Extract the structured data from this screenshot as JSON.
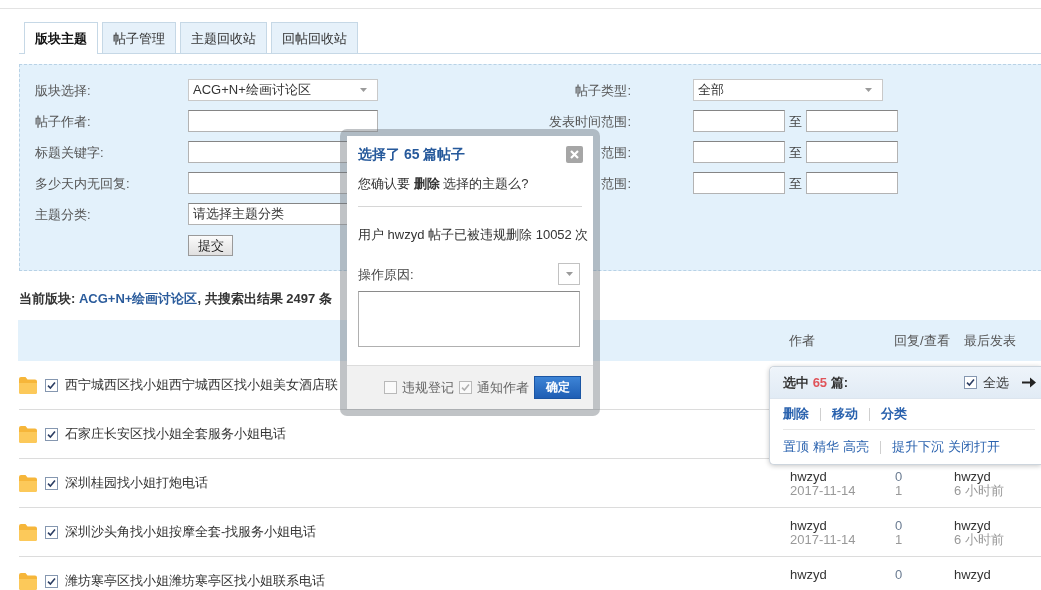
{
  "tabs": [
    {
      "label": "版块主题",
      "selected": true
    },
    {
      "label": "帖子管理",
      "selected": false
    },
    {
      "label": "主题回收站",
      "selected": false
    },
    {
      "label": "回帖回收站",
      "selected": false
    }
  ],
  "search_form": {
    "left_fields": [
      {
        "label": "版块选择:",
        "kind": "select",
        "value": "ACG+N+绘画讨论区"
      },
      {
        "label": "帖子作者:",
        "kind": "text"
      },
      {
        "label": "标题关键字:",
        "kind": "text"
      },
      {
        "label": "多少天内无回复:",
        "kind": "text"
      },
      {
        "label": "主题分类:",
        "kind": "text",
        "value": "请选择主题分类"
      }
    ],
    "right_fields": [
      {
        "label": "帖子类型:",
        "kind": "select",
        "value": "全部"
      },
      {
        "label": "发表时间范围:",
        "kind": "range",
        "separator": "至"
      },
      {
        "label": "范围:",
        "kind": "range",
        "separator": "至"
      },
      {
        "label": "范围:",
        "kind": "range",
        "separator": "至"
      }
    ],
    "submit_button": "提交"
  },
  "summary": {
    "prefix": "当前版块:",
    "forum": "ACG+N+绘画讨论区",
    "suffix": ", 共搜索出结果 2497 条"
  },
  "table": {
    "columns": [
      {
        "label": "作者"
      },
      {
        "label": "回复/查看"
      },
      {
        "label": "最后发表"
      }
    ],
    "rows": [
      {
        "title": "西宁城西区找小姐西宁城西区找小姐美女酒店联",
        "checked": true
      },
      {
        "title": "石家庄长安区找小姐全套服务小姐电话",
        "checked": true
      },
      {
        "title": "深圳桂园找小姐打炮电话",
        "checked": true,
        "author": "hwzyd",
        "date": "2017-11-14",
        "replies": "0",
        "views": "1",
        "last_poster": "hwzyd",
        "last_time": "6 小时前"
      },
      {
        "title": "深圳沙头角找小姐按摩全套-找服务小姐电话",
        "checked": true,
        "author": "hwzyd",
        "date": "2017-11-14",
        "replies": "0",
        "views": "1",
        "last_poster": "hwzyd",
        "last_time": "6 小时前"
      },
      {
        "title": "潍坊寒亭区找小姐潍坊寒亭区找小姐联系电话",
        "checked": true,
        "author": "hwzyd",
        "replies": "0",
        "last_poster": "hwzyd"
      }
    ]
  },
  "batch_panel": {
    "prefix": "选中",
    "count": "65",
    "suffix": "篇:",
    "select_all": {
      "label": "全选",
      "checked": true
    },
    "action_rows": [
      {
        "kind": "primary",
        "groups": [
          [
            "删除"
          ],
          [
            "移动"
          ],
          [
            "分类"
          ]
        ]
      },
      {
        "kind": "secondary",
        "groups": [
          [
            "置顶",
            "精华",
            "高亮"
          ],
          [
            "提升下沉",
            "关闭打开"
          ]
        ]
      }
    ]
  },
  "dialog": {
    "title": "选择了 65 篇帖子",
    "question": "您确认要 **删除** 选择的主题么?",
    "notice": "用户 hwzyd 帖子已被违规删除 10052 次",
    "reason_label": "操作原因:",
    "options": [
      {
        "label": "违规登记",
        "checked": false
      },
      {
        "label": "通知作者",
        "checked": true
      }
    ],
    "confirm_button": "确定"
  }
}
